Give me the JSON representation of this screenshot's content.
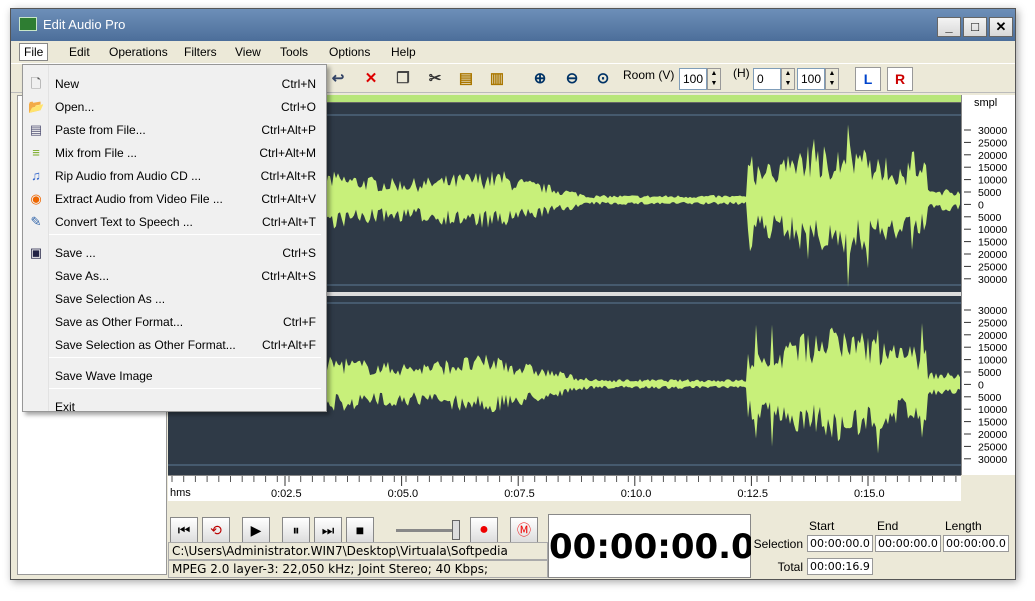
{
  "window": {
    "title": "Edit Audio Pro"
  },
  "menubar": [
    "File",
    "Edit",
    "Operations",
    "Filters",
    "View",
    "Tools",
    "Options",
    "Help"
  ],
  "toolbar": {
    "room_label": "Room (V)",
    "room_value": "100",
    "h_label": "(H)",
    "h_value": "0",
    "h2_value": "100",
    "left_channel": "L",
    "right_channel": "R"
  },
  "file_menu": [
    {
      "label": "New",
      "shortcut": "Ctrl+N",
      "icon": "new-file-icon"
    },
    {
      "label": "Open...",
      "shortcut": "Ctrl+O",
      "icon": "open-folder-icon"
    },
    {
      "label": "Paste from File...",
      "shortcut": "Ctrl+Alt+P",
      "icon": "paste-file-icon"
    },
    {
      "label": "Mix from File ...",
      "shortcut": "Ctrl+Alt+M",
      "icon": "mix-file-icon"
    },
    {
      "label": "Rip Audio from Audio CD ...",
      "shortcut": "Ctrl+Alt+R",
      "icon": "music-note-icon"
    },
    {
      "label": "Extract Audio from Video File ...",
      "shortcut": "Ctrl+Alt+V",
      "icon": "video-icon"
    },
    {
      "label": "Convert Text to Speech ...",
      "shortcut": "Ctrl+Alt+T",
      "icon": "pencil-icon"
    },
    {
      "label": "Save ...",
      "shortcut": "Ctrl+S",
      "icon": "floppy-icon"
    },
    {
      "label": "Save As...",
      "shortcut": "Ctrl+Alt+S",
      "icon": ""
    },
    {
      "label": "Save Selection As ...",
      "shortcut": "",
      "icon": ""
    },
    {
      "label": "Save as Other Format...",
      "shortcut": "Ctrl+F",
      "icon": ""
    },
    {
      "label": "Save Selection as Other Format...",
      "shortcut": "Ctrl+Alt+F",
      "icon": ""
    },
    {
      "label": "Save Wave Image",
      "shortcut": "",
      "icon": ""
    },
    {
      "label": "Exit",
      "shortcut": "",
      "icon": ""
    }
  ],
  "ruler": {
    "unit": "smpl",
    "top_labels": [
      "30000",
      "25000",
      "20000",
      "15000",
      "10000",
      "5000",
      "0",
      "5000",
      "10000",
      "15000",
      "20000",
      "25000",
      "30000"
    ],
    "bottom_labels": [
      "30000",
      "25000",
      "20000",
      "15000",
      "10000",
      "5000",
      "0",
      "5000",
      "10000",
      "15000",
      "20000",
      "25000",
      "30000"
    ]
  },
  "time_ruler": {
    "unit": "hms",
    "labels": [
      "0:02.5",
      "0:05.0",
      "0:07.5",
      "0:10.0",
      "0:12.5",
      "0:15.0"
    ]
  },
  "status": {
    "path": "C:\\Users\\Administrator.WIN7\\Desktop\\Virtuala\\Softpedia",
    "format": "MPEG 2.0 layer-3: 22,050 kHz; Joint Stereo; 40 Kbps;",
    "timer": "00:00:00.0"
  },
  "selection": {
    "start_header": "Start",
    "end_header": "End",
    "length_header": "Length",
    "selection_label": "Selection",
    "total_label": "Total",
    "start": "00:00:00.0",
    "end": "00:00:00.0",
    "length": "00:00:00.0",
    "total": "00:00:16.9"
  },
  "colors": {
    "waveform": "#c8f07a",
    "wave_bg": "#2f3a47"
  }
}
